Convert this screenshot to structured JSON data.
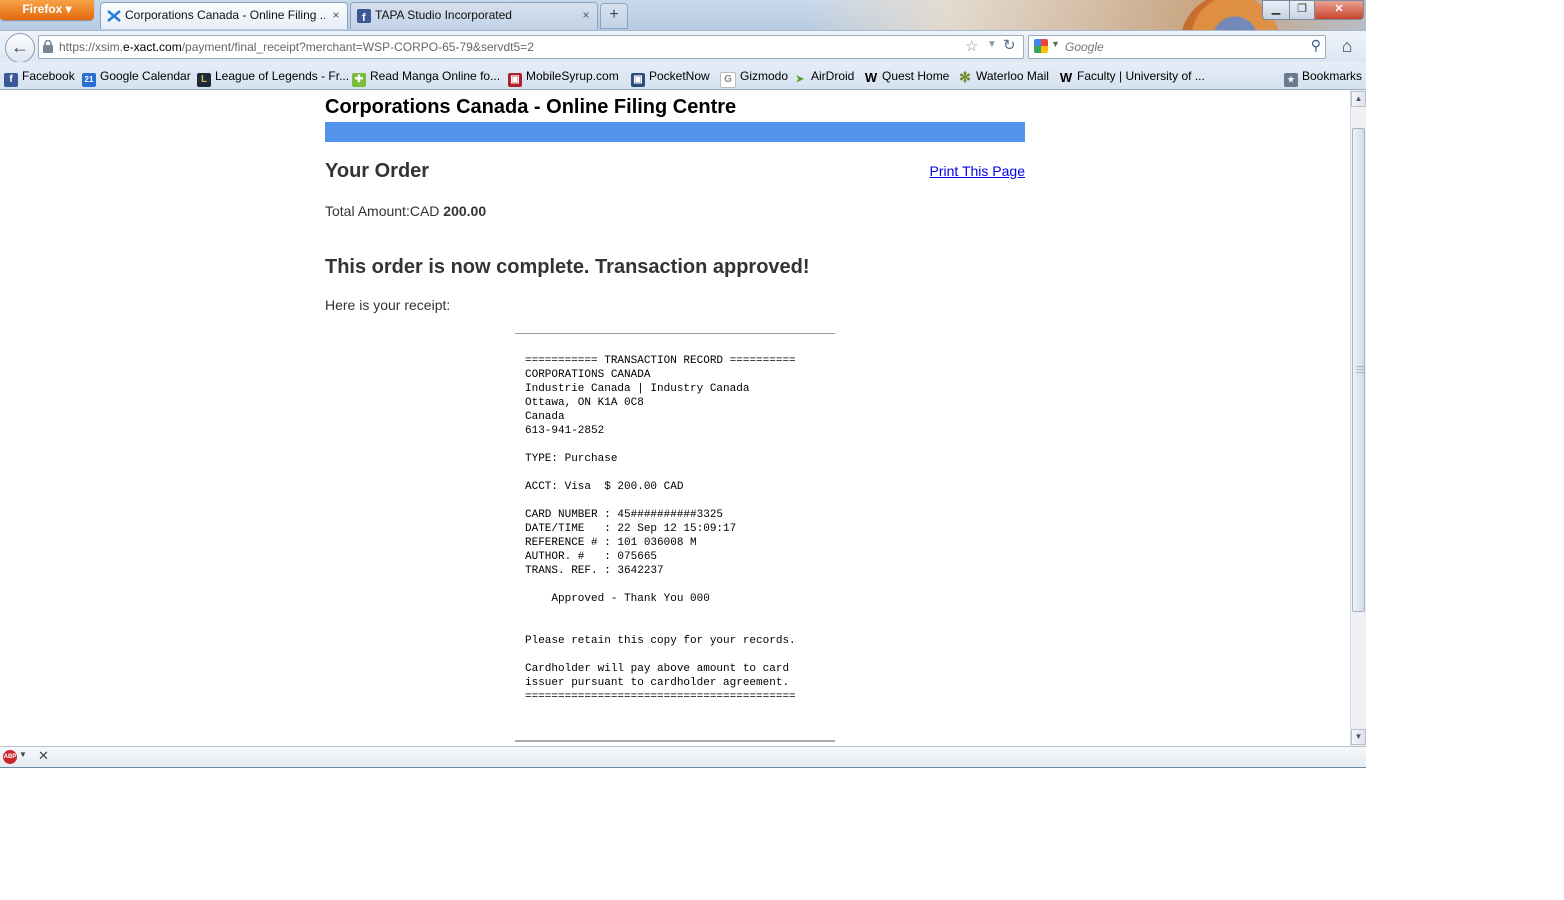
{
  "browser": {
    "menu_button": "Firefox ▾",
    "tabs": [
      {
        "label": "Corporations Canada - Online Filing ...",
        "close": "×"
      },
      {
        "label": "TAPA Studio Incorporated",
        "close": "×"
      }
    ],
    "new_tab": "+",
    "window_controls": {
      "minimize": "▁",
      "maximize": "❐",
      "close": "✕"
    },
    "url_prefix": "https://xsim.",
    "url_domain": "e-xact.com",
    "url_suffix": "/payment/final_receipt?merchant=WSP-CORPO-65-79&servdt5=2",
    "search_placeholder": "Google",
    "bookmarks": [
      {
        "label": "Facebook",
        "icon": "facebook-icon",
        "icon_text": "f",
        "color": "#3b5998"
      },
      {
        "label": "Google Calendar",
        "icon": "calendar-icon",
        "icon_text": "21",
        "color": "#2a6fd6"
      },
      {
        "label": "League of Legends - Fr...",
        "icon": "league-icon",
        "icon_text": "L",
        "color": "#1c2b3a"
      },
      {
        "label": "Read Manga Online fo...",
        "icon": "manga-icon",
        "icon_text": "✚",
        "color": "#7cbc3c"
      },
      {
        "label": "MobileSyrup.com",
        "icon": "mobilesyrup-icon",
        "icon_text": "▣",
        "color": "#b3202a"
      },
      {
        "label": "PocketNow",
        "icon": "pocketnow-icon",
        "icon_text": "▣",
        "color": "#2b4f7a"
      },
      {
        "label": "Gizmodo",
        "icon": "gizmodo-icon",
        "icon_text": "G",
        "color": "#8a8a8a"
      },
      {
        "label": "AirDroid",
        "icon": "airdroid-icon",
        "icon_text": "➤",
        "color": "#5aa02c"
      },
      {
        "label": "Quest Home",
        "icon": "waterloo-w-icon",
        "icon_text": "W",
        "color": "#000000"
      },
      {
        "label": "Waterloo Mail",
        "icon": "gear-icon",
        "icon_text": "✻",
        "color": "#6e8b2a"
      },
      {
        "label": "Faculty | University of ...",
        "icon": "waterloo-w-icon",
        "icon_text": "W",
        "color": "#000000"
      }
    ],
    "bookmarks_menu": "Bookmarks"
  },
  "page": {
    "site_title": "Corporations Canada - Online Filing Centre",
    "order_heading": "Your Order",
    "print_link": "Print This Page",
    "total_label": "Total Amount:CAD ",
    "total_value": "200.00",
    "complete_message": "This order is now complete. Transaction approved!",
    "receipt_intro": "Here is your receipt:",
    "receipt_lines": [
      "=========== TRANSACTION RECORD ==========",
      "CORPORATIONS CANADA",
      "Industrie Canada | Industry Canada",
      "Ottawa, ON K1A 0C8",
      "Canada",
      "613-941-2852",
      "",
      "TYPE: Purchase",
      "",
      "ACCT: Visa  $ 200.00 CAD",
      "",
      "CARD NUMBER : 45##########3325",
      "DATE/TIME   : 22 Sep 12 15:09:17",
      "REFERENCE # : 101 036008 M",
      "AUTHOR. #   : 075665",
      "TRANS. REF. : 3642237",
      "",
      "    Approved - Thank You 000",
      "",
      "",
      "Please retain this copy for your records.",
      "",
      "Cardholder will pay above amount to card",
      "issuer pursuant to cardholder agreement.",
      "========================================="
    ]
  },
  "addon_bar": {
    "abp_label": "ABP",
    "close": "✕"
  },
  "colors": {
    "header_bar": "#5294ec",
    "link": "#0000ee",
    "firefox_orange": "#e4690b"
  }
}
